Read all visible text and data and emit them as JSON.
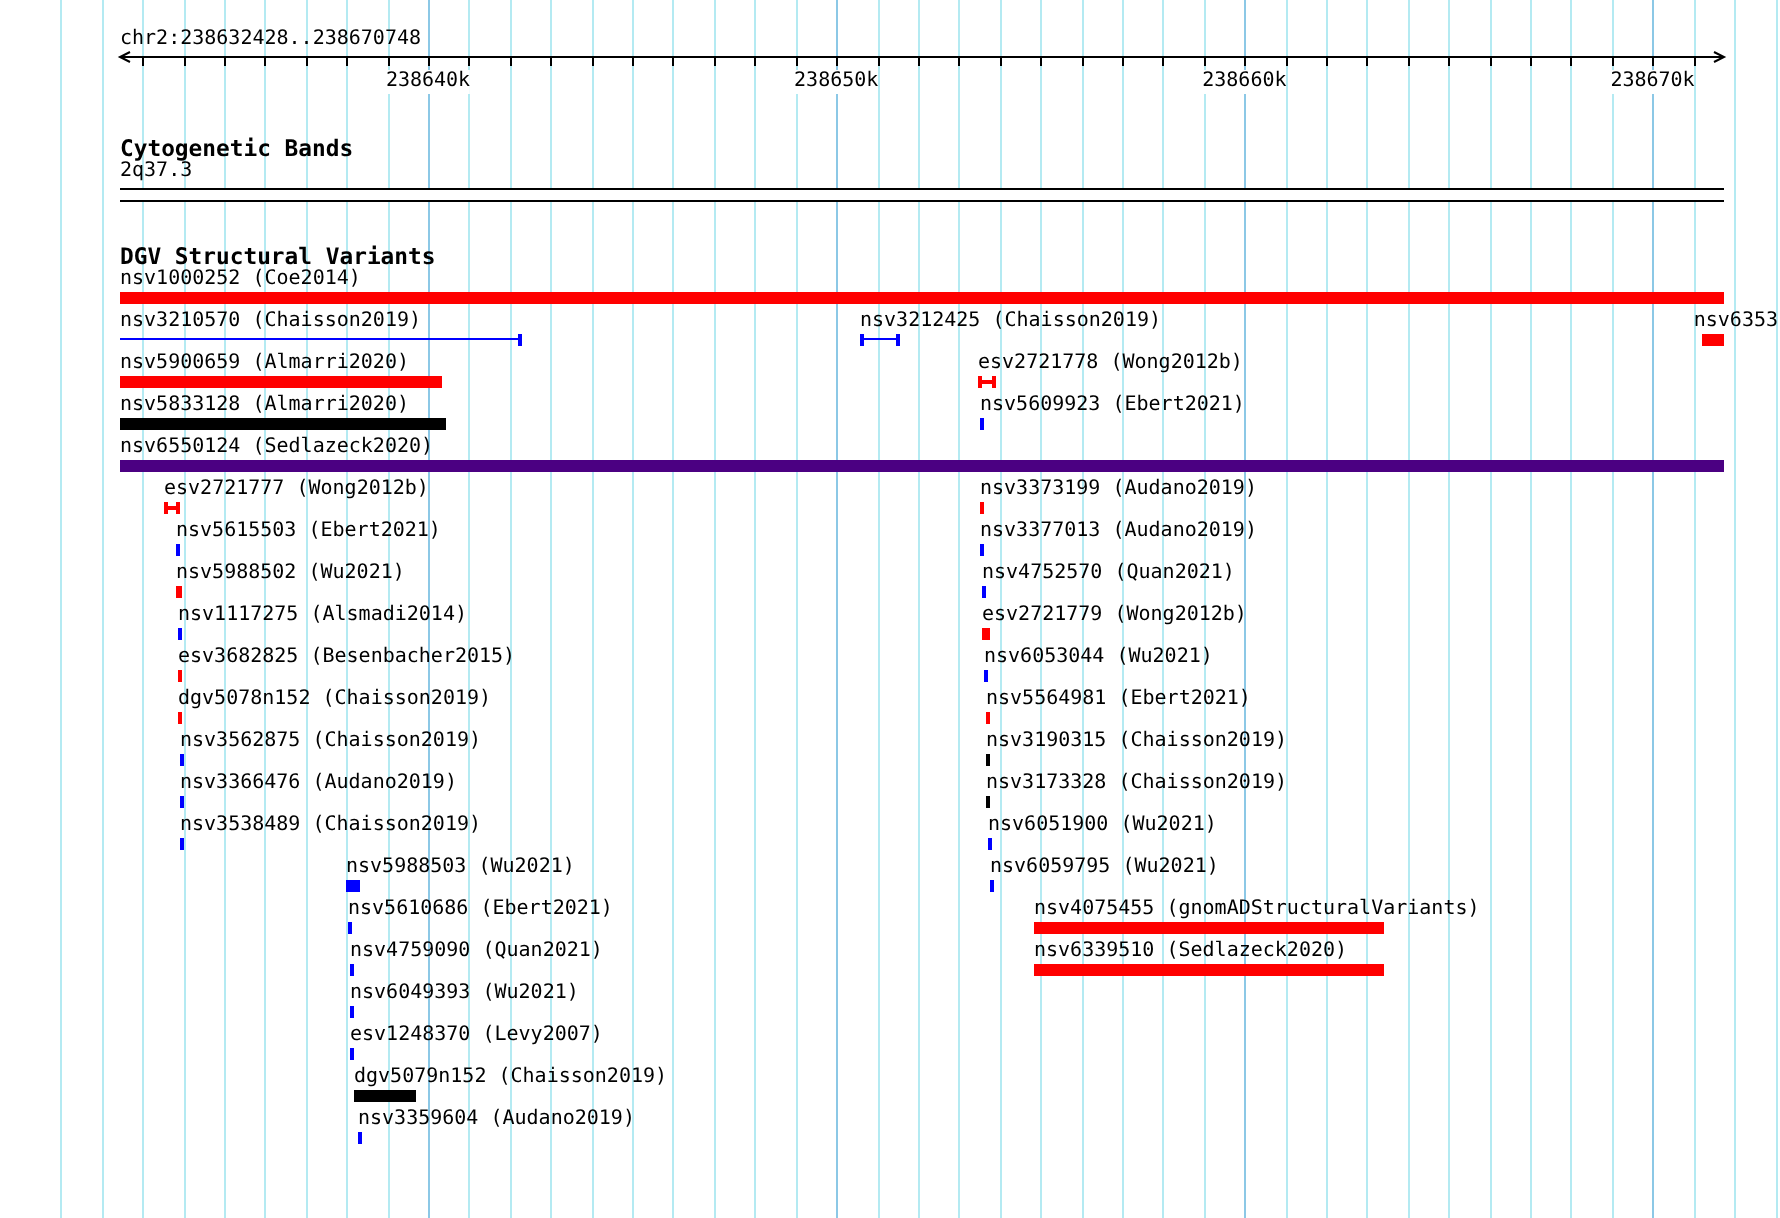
{
  "location": "chr2:238632428..238670748",
  "ruler": {
    "ticks": [
      {
        "label": "238640k"
      },
      {
        "label": "238650k"
      },
      {
        "label": "238660k"
      },
      {
        "label": "238670k"
      }
    ]
  },
  "tracks": [
    {
      "title": "Cytogenetic Bands",
      "kind": "bands",
      "bands": [
        {
          "name": "2q37.3"
        }
      ]
    },
    {
      "title": "DGV Structural Variants",
      "kind": "features",
      "rows": [
        {
          "features": [
            {
              "name": "nsv1000252 (Coe2014)",
              "kind": "bar",
              "color": "#ff0000"
            }
          ]
        },
        {
          "features": [
            {
              "name": "nsv3210570 (Chaisson2019)",
              "kind": "line",
              "color": "#0000ff"
            },
            {
              "name": "nsv3212425 (Chaisson2019)",
              "kind": "line",
              "color": "#0000ff"
            },
            {
              "name": "nsv6353",
              "kind": "bar",
              "color": "#ff0000"
            }
          ]
        },
        {
          "features": [
            {
              "name": "nsv5900659 (Almarri2020)",
              "kind": "bar",
              "color": "#ff0000"
            },
            {
              "name": "esv2721778 (Wong2012b)",
              "kind": "interval",
              "color": "#ff0000"
            }
          ]
        },
        {
          "features": [
            {
              "name": "nsv5833128 (Almarri2020)",
              "kind": "bar",
              "color": "#000000"
            },
            {
              "name": "nsv5609923 (Ebert2021)",
              "kind": "bar",
              "color": "#0000ff"
            }
          ]
        },
        {
          "features": [
            {
              "name": "nsv6550124 (Sedlazeck2020)",
              "kind": "bar",
              "color": "#4b0082"
            }
          ]
        },
        {
          "features": [
            {
              "name": "esv2721777 (Wong2012b)",
              "kind": "interval",
              "color": "#ff0000"
            },
            {
              "name": "nsv3373199 (Audano2019)",
              "kind": "bar",
              "color": "#ff0000"
            }
          ]
        },
        {
          "features": [
            {
              "name": "nsv5615503 (Ebert2021)",
              "kind": "bar",
              "color": "#0000ff"
            },
            {
              "name": "nsv3377013 (Audano2019)",
              "kind": "bar",
              "color": "#0000ff"
            }
          ]
        },
        {
          "features": [
            {
              "name": "nsv5988502 (Wu2021)",
              "kind": "bar",
              "color": "#ff0000"
            },
            {
              "name": "nsv4752570 (Quan2021)",
              "kind": "bar",
              "color": "#0000ff"
            }
          ]
        },
        {
          "features": [
            {
              "name": "nsv1117275 (Alsmadi2014)",
              "kind": "bar",
              "color": "#0000ff"
            },
            {
              "name": "esv2721779 (Wong2012b)",
              "kind": "interval",
              "color": "#ff0000"
            }
          ]
        },
        {
          "features": [
            {
              "name": "esv3682825 (Besenbacher2015)",
              "kind": "bar",
              "color": "#ff0000"
            },
            {
              "name": "nsv6053044 (Wu2021)",
              "kind": "bar",
              "color": "#0000ff"
            }
          ]
        },
        {
          "features": [
            {
              "name": "dgv5078n152 (Chaisson2019)",
              "kind": "bar",
              "color": "#ff0000"
            },
            {
              "name": "nsv5564981 (Ebert2021)",
              "kind": "bar",
              "color": "#ff0000"
            }
          ]
        },
        {
          "features": [
            {
              "name": "nsv3562875 (Chaisson2019)",
              "kind": "bar",
              "color": "#0000ff"
            },
            {
              "name": "nsv3190315 (Chaisson2019)",
              "kind": "bar",
              "color": "#000000"
            }
          ]
        },
        {
          "features": [
            {
              "name": "nsv3366476 (Audano2019)",
              "kind": "bar",
              "color": "#0000ff"
            },
            {
              "name": "nsv3173328 (Chaisson2019)",
              "kind": "bar",
              "color": "#000000"
            }
          ]
        },
        {
          "features": [
            {
              "name": "nsv3538489 (Chaisson2019)",
              "kind": "bar",
              "color": "#0000ff"
            },
            {
              "name": "nsv6051900 (Wu2021)",
              "kind": "bar",
              "color": "#0000ff"
            }
          ]
        },
        {
          "features": [
            {
              "name": "nsv5988503 (Wu2021)",
              "kind": "bar",
              "color": "#0000ff"
            },
            {
              "name": "nsv6059795 (Wu2021)",
              "kind": "bar",
              "color": "#0000ff"
            }
          ]
        },
        {
          "features": [
            {
              "name": "nsv5610686 (Ebert2021)",
              "kind": "bar",
              "color": "#0000ff"
            },
            {
              "name": "nsv4075455 (gnomADStructuralVariants)",
              "kind": "bar",
              "color": "#ff0000"
            }
          ]
        },
        {
          "features": [
            {
              "name": "nsv4759090 (Quan2021)",
              "kind": "bar",
              "color": "#0000ff"
            },
            {
              "name": "nsv6339510 (Sedlazeck2020)",
              "kind": "bar",
              "color": "#ff0000"
            }
          ]
        },
        {
          "features": [
            {
              "name": "nsv6049393 (Wu2021)",
              "kind": "bar",
              "color": "#0000ff"
            }
          ]
        },
        {
          "features": [
            {
              "name": "esv1248370 (Levy2007)",
              "kind": "bar",
              "color": "#0000ff"
            }
          ]
        },
        {
          "features": [
            {
              "name": "dgv5079n152 (Chaisson2019)",
              "kind": "bar",
              "color": "#000000"
            }
          ]
        },
        {
          "features": [
            {
              "name": "nsv3359604 (Audano2019)",
              "kind": "bar",
              "color": "#0000ff"
            }
          ]
        }
      ]
    }
  ]
}
